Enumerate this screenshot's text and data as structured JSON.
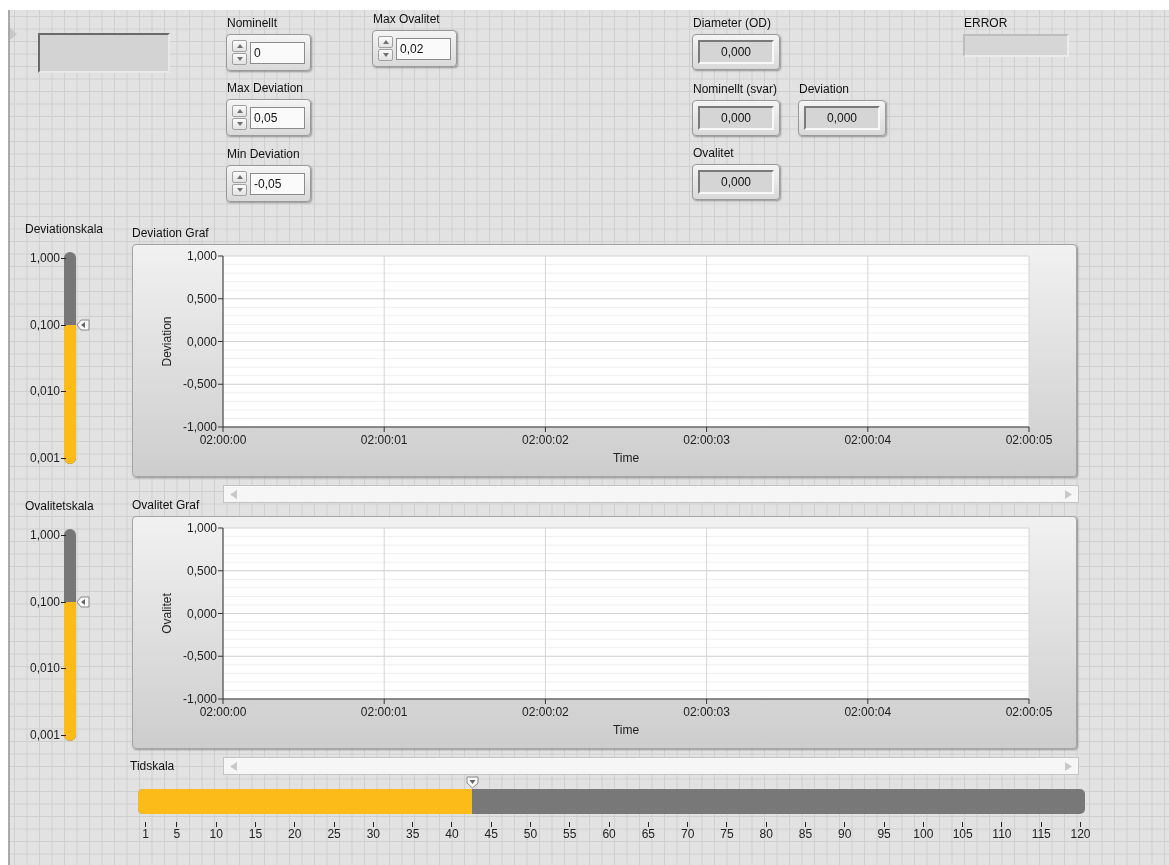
{
  "controls": [
    {
      "kind": "textbox"
    },
    {
      "kind": "numeric",
      "label": "Nominellt",
      "value": "0"
    },
    {
      "kind": "numeric",
      "label": "Max Ovalitet",
      "value": "0,02"
    },
    {
      "kind": "readout",
      "label": "Diameter (OD)",
      "value": "0,000"
    },
    {
      "kind": "errorbox",
      "label": "ERROR"
    },
    {
      "kind": "numeric",
      "label": "Max Deviation",
      "value": "0,05"
    },
    {
      "kind": "readout",
      "label": "Nominellt (svar)",
      "value": "0,000"
    },
    {
      "kind": "readout",
      "label": "Deviation",
      "value": "0,000"
    },
    {
      "kind": "numeric",
      "label": "Min Deviation",
      "value": "-0,05"
    },
    {
      "kind": "readout",
      "label": "Ovalitet",
      "value": "0,000"
    }
  ],
  "scales": [
    {
      "label": "Deviationskala",
      "ticks": [
        "1,000",
        "0,100",
        "0,010",
        "0,001"
      ],
      "level": 0.665
    },
    {
      "label": "Ovalitetskala",
      "ticks": [
        "1,000",
        "0,100",
        "0,010",
        "0,001"
      ],
      "level": 0.665
    }
  ],
  "graphs": [
    {
      "chart_data": {
        "type": "line",
        "title": "Deviation Graf",
        "xlabel": "Time",
        "ylabel": "Deviation",
        "grid": true,
        "ylim": [
          -1,
          1
        ],
        "categories": [
          "02:00:00",
          "02:00:01",
          "02:00:02",
          "02:00:03",
          "02:00:04",
          "02:00:05"
        ],
        "yticks": [
          {
            "value": 1,
            "label": "1,000"
          },
          {
            "value": 0.5,
            "label": "0,500"
          },
          {
            "value": 0,
            "label": "0,000"
          },
          {
            "value": -0.5,
            "label": "-0,500"
          },
          {
            "value": -1,
            "label": "-1,000"
          }
        ]
      }
    },
    {
      "chart_data": {
        "type": "line",
        "title": "Ovalitet Graf",
        "xlabel": "Time",
        "ylabel": "Ovalitet",
        "grid": true,
        "ylim": [
          -1,
          1
        ],
        "categories": [
          "02:00:00",
          "02:00:01",
          "02:00:02",
          "02:00:03",
          "02:00:04",
          "02:00:05"
        ],
        "yticks": [
          {
            "value": 1,
            "label": "1,000"
          },
          {
            "value": 0.5,
            "label": "0,500"
          },
          {
            "value": 0,
            "label": "0,000"
          },
          {
            "value": -0.5,
            "label": "-0,500"
          },
          {
            "value": -1,
            "label": "-1,000"
          }
        ]
      }
    }
  ],
  "time_scale": {
    "label": "Tidskala",
    "ticks": [
      "1",
      "5",
      "10",
      "15",
      "20",
      "25",
      "30",
      "35",
      "40",
      "45",
      "50",
      "55",
      "60",
      "65",
      "70",
      "75",
      "80",
      "85",
      "90",
      "95",
      "100",
      "105",
      "110",
      "115",
      "120"
    ],
    "level": 0.35
  }
}
